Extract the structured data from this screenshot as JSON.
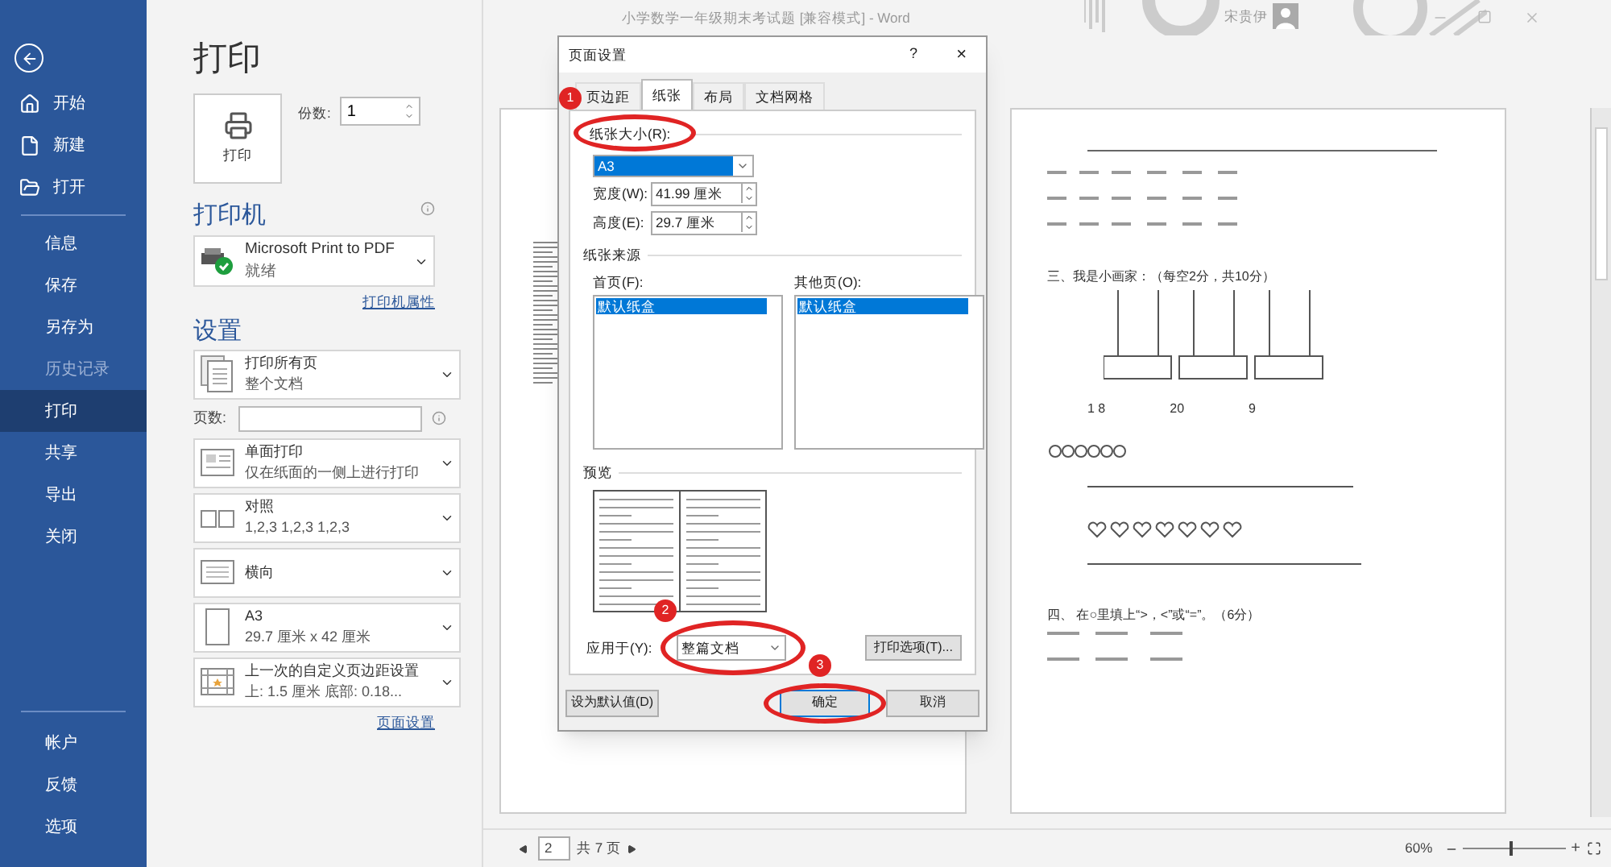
{
  "window": {
    "title": "小学数学一年级期末考试题 [兼容模式]  -  Word",
    "user": "宋贵伊"
  },
  "nav": {
    "top": [
      {
        "label": "开始",
        "selected": false,
        "disabled": false
      },
      {
        "label": "新建",
        "selected": false,
        "disabled": false
      },
      {
        "label": "打开",
        "selected": false,
        "disabled": false
      }
    ],
    "middle": [
      {
        "label": "信息",
        "selected": false,
        "disabled": false
      },
      {
        "label": "保存",
        "selected": false,
        "disabled": false
      },
      {
        "label": "另存为",
        "selected": false,
        "disabled": false
      },
      {
        "label": "历史记录",
        "selected": false,
        "disabled": true
      },
      {
        "label": "打印",
        "selected": true,
        "disabled": false
      },
      {
        "label": "共享",
        "selected": false,
        "disabled": false
      },
      {
        "label": "导出",
        "selected": false,
        "disabled": false
      },
      {
        "label": "关闭",
        "selected": false,
        "disabled": false
      }
    ],
    "bottom": [
      {
        "label": "帐户",
        "selected": false,
        "disabled": false
      },
      {
        "label": "反馈",
        "selected": false,
        "disabled": false
      },
      {
        "label": "选项",
        "selected": false,
        "disabled": false
      }
    ]
  },
  "print": {
    "heading": "打印",
    "print_button": "打印",
    "copies_label": "份数:",
    "copies": "1",
    "printer_heading": "打印机",
    "printer": {
      "name": "Microsoft Print to PDF",
      "status": "就绪"
    },
    "printer_properties": "打印机属性",
    "settings_heading": "设置",
    "settings": [
      {
        "kind": "pages",
        "title": "打印所有页",
        "subtitle": "整个文档"
      },
      {
        "kind": "pages_field",
        "label": "页数:"
      },
      {
        "kind": "sides",
        "title": "单面打印",
        "subtitle": "仅在纸面的一侧上进行打印"
      },
      {
        "kind": "collate",
        "title": "对照",
        "subtitle": "1,2,3    1,2,3    1,2,3"
      },
      {
        "kind": "orientation",
        "title": "横向"
      },
      {
        "kind": "paper",
        "title": "A3",
        "subtitle": "29.7 厘米 x 42 厘米"
      },
      {
        "kind": "margins",
        "title": "上一次的自定义页边距设置",
        "subtitle": "上: 1.5 厘米 底部: 0.18..."
      }
    ],
    "page_setup_link": "页面设置"
  },
  "preview": {
    "right_page": {
      "heading_3": "三、我是小画家：（每空2分，共10分）",
      "numbers": [
        "1 8",
        "20",
        "9"
      ],
      "heading_4": "四、 在○里填上“>，<”或“=”。（6分）"
    },
    "page": "2",
    "page_count": "共 7 页",
    "zoom": "60%",
    "zoom_slider": {
      "level": 0.45
    },
    "zoom_in": "+"
  },
  "dialog": {
    "title": "页面设置",
    "help": "?",
    "close": "×",
    "tabs": [
      {
        "label": "页边距",
        "selected": false
      },
      {
        "label": "纸张",
        "selected": true
      },
      {
        "label": "布局",
        "selected": false
      },
      {
        "label": "文档网格",
        "selected": false
      }
    ],
    "paper_size_label": "纸张大小(R):",
    "paper_size": "A3",
    "width_label": "宽度(W):",
    "width": "41.99 厘米",
    "height_label": "高度(E):",
    "height": "29.7 厘米",
    "source_heading": "纸张来源",
    "first_page": {
      "label": "首页(F):",
      "items": [
        {
          "label": "默认纸盒",
          "selected": true
        }
      ]
    },
    "other_pages": {
      "label": "其他页(O):",
      "items": [
        {
          "label": "默认纸盒",
          "selected": true
        }
      ]
    },
    "preview_heading": "预览",
    "apply_label": "应用于(Y):",
    "apply_value": "整篇文档",
    "print_options": "打印选项(T)...",
    "buttons": [
      {
        "label": "设为默认值(D)",
        "kind": "default"
      },
      {
        "label": "确定",
        "kind": "ok"
      },
      {
        "label": "取消",
        "kind": "cancel"
      }
    ]
  },
  "annotations": [
    "1",
    "2",
    "3"
  ]
}
